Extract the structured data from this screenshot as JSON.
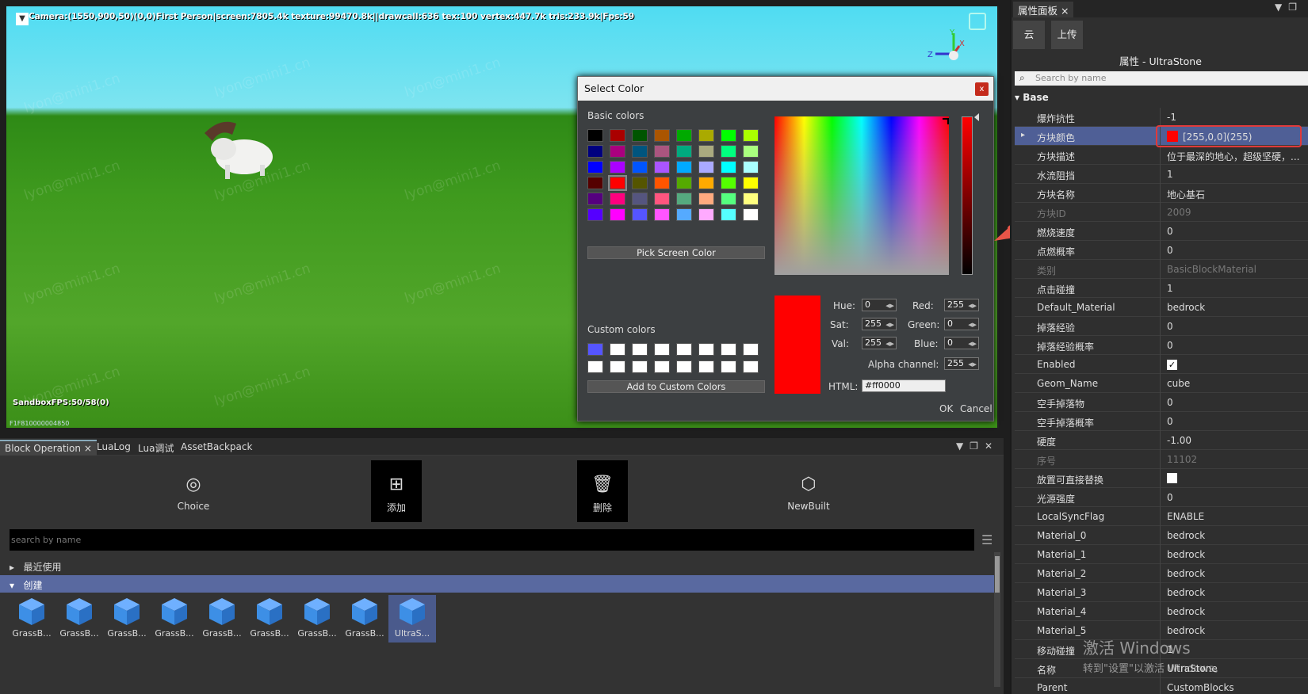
{
  "viewport": {
    "stats": "Camera:(1550,900,50)(0,0)First Person|screen:7805.4k texture:99470.8k||drawcall:636 tex:100 vertex:447.7k tris:233.9k|Fps:59",
    "fps": "SandboxFPS:50/58(0)",
    "code": "F1F810000004850",
    "watermark": "lyon@mini1.cn",
    "toggle_icon": "chevron-down-icon",
    "colors": {
      "sky": "#5fe0f2",
      "grass": "#45a020"
    }
  },
  "color_dialog": {
    "title": "Select Color",
    "close": "x",
    "basic_label": "Basic colors",
    "basic_colors": [
      "#000000",
      "#aa0000",
      "#005500",
      "#aa5500",
      "#00aa00",
      "#aaaa00",
      "#00ff00",
      "#aaff00",
      "#00007f",
      "#aa007f",
      "#00557f",
      "#aa557f",
      "#00aa7f",
      "#aaaa7f",
      "#00ff7f",
      "#aaff7f",
      "#0000ff",
      "#aa00ff",
      "#0055ff",
      "#aa55ff",
      "#00aaff",
      "#aaaaff",
      "#00ffff",
      "#aaffff",
      "#550000",
      "#ff0000",
      "#555500",
      "#ff5500",
      "#55aa00",
      "#ffaa00",
      "#55ff00",
      "#ffff00",
      "#55007f",
      "#ff007f",
      "#55557f",
      "#ff557f",
      "#55aa7f",
      "#ffaa7f",
      "#55ff7f",
      "#ffff7f",
      "#5500ff",
      "#ff00ff",
      "#5555ff",
      "#ff55ff",
      "#55aaff",
      "#ffaaff",
      "#55ffff",
      "#ffffff"
    ],
    "pick_screen": "Pick Screen Color",
    "custom_label": "Custom colors",
    "custom_colors": [
      "#5555ff",
      "#ffffff",
      "#ffffff",
      "#ffffff",
      "#ffffff",
      "#ffffff",
      "#ffffff",
      "#ffffff",
      "#ffffff",
      "#ffffff",
      "#ffffff",
      "#ffffff",
      "#ffffff",
      "#ffffff",
      "#ffffff",
      "#ffffff"
    ],
    "add_custom": "Add to Custom Colors",
    "fields": {
      "hue_label": "Hue:",
      "hue": "0",
      "sat_label": "Sat:",
      "sat": "255",
      "val_label": "Val:",
      "val": "255",
      "red_label": "Red:",
      "red": "255",
      "green_label": "Green:",
      "green": "0",
      "blue_label": "Blue:",
      "blue": "0",
      "alpha_label": "Alpha channel:",
      "alpha": "255",
      "html_label": "HTML:",
      "html": "#ff0000"
    },
    "ok": "OK",
    "cancel": "Cancel",
    "current_color": "#ff0000"
  },
  "bottom_panel": {
    "tabs": [
      "Block Operation",
      "LuaLog",
      "Lua调试",
      "AssetBackpack"
    ],
    "tab_close": "×",
    "tools": [
      {
        "label": "Choice",
        "icon": "cursor-select-icon"
      },
      {
        "label": "添加",
        "icon": "plus-icon"
      },
      {
        "label": "删除",
        "icon": "trash-icon"
      },
      {
        "label": "NewBuilt",
        "icon": "new-block-icon"
      }
    ],
    "search_placeholder": "search by name",
    "recent": "最近使用",
    "create": "创建",
    "items": [
      "GrassB...",
      "GrassB...",
      "GrassB...",
      "GrassB...",
      "GrassB...",
      "GrassB...",
      "GrassB...",
      "GrassB...",
      "UltraS..."
    ],
    "item_color": "#3d8fe6"
  },
  "right_panel": {
    "tab": "属性面板",
    "tab_close": "×",
    "btn_cloud": "云",
    "btn_upload": "上传",
    "title": "属性 - UltraStone",
    "search_placeholder": "Search by name",
    "section": "Base",
    "props": [
      {
        "k": "爆炸抗性",
        "v": "-1"
      },
      {
        "k": "方块颜色",
        "v": "[255,0,0](255)"
      },
      {
        "k": "方块描述",
        "v": "位于最深的地心，超级坚硬，..."
      },
      {
        "k": "水流阻挡",
        "v": "1"
      },
      {
        "k": "方块名称",
        "v": "地心基石"
      },
      {
        "k": "方块ID",
        "v": "2009"
      },
      {
        "k": "燃烧速度",
        "v": "0"
      },
      {
        "k": "点燃概率",
        "v": "0"
      },
      {
        "k": "类别",
        "v": "BasicBlockMaterial"
      },
      {
        "k": "点击碰撞",
        "v": "1"
      },
      {
        "k": "Default_Material",
        "v": "bedrock"
      },
      {
        "k": "掉落经验",
        "v": "0"
      },
      {
        "k": "掉落经验概率",
        "v": "0"
      },
      {
        "k": "Enabled",
        "v": "✓"
      },
      {
        "k": "Geom_Name",
        "v": "cube"
      },
      {
        "k": "空手掉落物",
        "v": "0"
      },
      {
        "k": "空手掉落概率",
        "v": "0"
      },
      {
        "k": "硬度",
        "v": "-1.00"
      },
      {
        "k": "序号",
        "v": "11102"
      },
      {
        "k": "放置可直接替换",
        "v": ""
      },
      {
        "k": "光源强度",
        "v": "0"
      },
      {
        "k": "LocalSyncFlag",
        "v": "ENABLE"
      },
      {
        "k": "Material_0",
        "v": "bedrock"
      },
      {
        "k": "Material_1",
        "v": "bedrock"
      },
      {
        "k": "Material_2",
        "v": "bedrock"
      },
      {
        "k": "Material_3",
        "v": "bedrock"
      },
      {
        "k": "Material_4",
        "v": "bedrock"
      },
      {
        "k": "Material_5",
        "v": "bedrock"
      },
      {
        "k": "移动碰撞",
        "v": "1"
      },
      {
        "k": "名称",
        "v": "UltraStone"
      },
      {
        "k": "Parent",
        "v": "CustomBlocks"
      }
    ]
  },
  "activate": {
    "line1": "激活 Windows",
    "line2": "转到\"设置\"以激活 Windows。"
  },
  "accent": "#e03a3a"
}
